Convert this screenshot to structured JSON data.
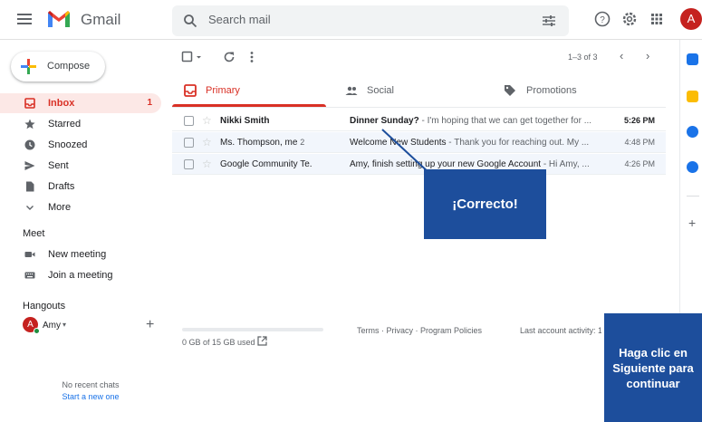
{
  "app": {
    "name": "Gmail",
    "account_initial": "A"
  },
  "search": {
    "placeholder": "Search mail"
  },
  "compose": {
    "label": "Compose"
  },
  "nav": [
    {
      "label": "Inbox",
      "count": "1",
      "icon": "inbox-icon"
    },
    {
      "label": "Starred",
      "icon": "star-icon"
    },
    {
      "label": "Snoozed",
      "icon": "clock-icon"
    },
    {
      "label": "Sent",
      "icon": "send-icon"
    },
    {
      "label": "Drafts",
      "icon": "draft-icon"
    },
    {
      "label": "More",
      "icon": "chevron-down-icon"
    }
  ],
  "meet": {
    "title": "Meet",
    "items": [
      {
        "label": "New meeting",
        "icon": "video-icon"
      },
      {
        "label": "Join a meeting",
        "icon": "keyboard-icon"
      }
    ]
  },
  "hangouts": {
    "title": "Hangouts",
    "user": "Amy",
    "user_initial": "A",
    "no_chats": "No recent chats",
    "start_new": "Start a new one"
  },
  "toolbar": {
    "page_count": "1–3 of 3"
  },
  "tabs": [
    {
      "label": "Primary",
      "icon": "inbox-icon",
      "active": true
    },
    {
      "label": "Social",
      "icon": "people-icon"
    },
    {
      "label": "Promotions",
      "icon": "tag-icon"
    }
  ],
  "emails": [
    {
      "sender": "Nikki Smith",
      "thread_count": "",
      "subject": "Dinner Sunday?",
      "preview": " - I'm hoping that we can get together for ...",
      "time": "5:26 PM",
      "unread": true
    },
    {
      "sender": "Ms. Thompson, me",
      "thread_count": "2",
      "subject": "Welcome New Students",
      "preview": " - Thank you for reaching out. My ...",
      "time": "4:48 PM",
      "unread": false
    },
    {
      "sender": "Google Community Te.",
      "thread_count": "",
      "subject": "Amy, finish setting up your new Google Account",
      "preview": " - Hi Amy, ...",
      "time": "4:26 PM",
      "unread": false
    }
  ],
  "footer": {
    "storage": "0 GB of 15 GB used",
    "links": "Terms · Privacy · Program Policies",
    "last_activity": "Last account activity: 1"
  },
  "tutorial": {
    "feedback": "¡Correcto!",
    "next_hint": "Haga clic en Siguiente para continuar"
  },
  "colors": {
    "accent_red": "#d93025",
    "tutorial_blue": "#1d4e9c",
    "read_row_bg": "#f2f6fc"
  }
}
